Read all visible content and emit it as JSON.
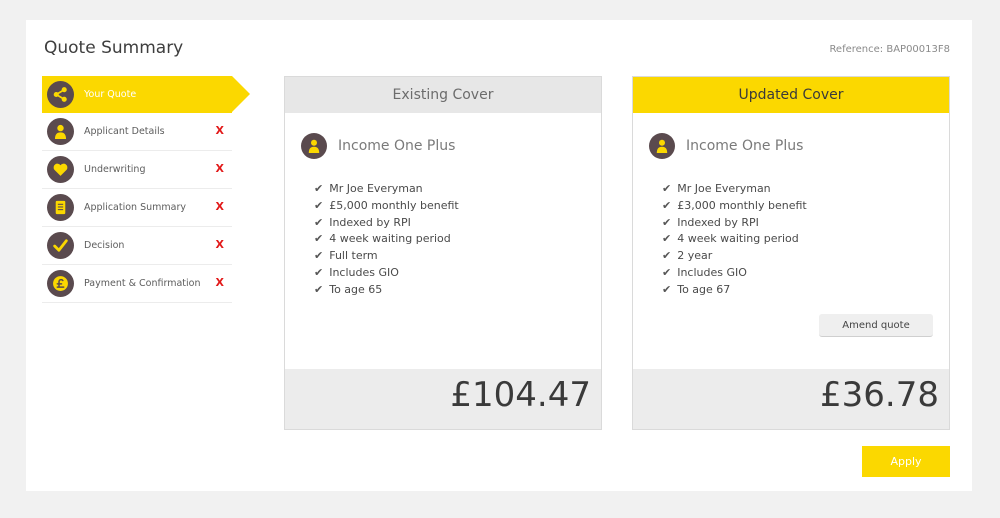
{
  "header": {
    "title": "Quote Summary",
    "reference": "Reference: BAP00013F8"
  },
  "steps": [
    {
      "label": "Your Quote",
      "icon": "share-icon",
      "status": ""
    },
    {
      "label": "Applicant Details",
      "icon": "person-icon",
      "status": "X"
    },
    {
      "label": "Underwriting",
      "icon": "heart-icon",
      "status": "X"
    },
    {
      "label": "Application Summary",
      "icon": "document-icon",
      "status": "X"
    },
    {
      "label": "Decision",
      "icon": "checkmark-icon",
      "status": "X"
    },
    {
      "label": "Payment & Confirmation",
      "icon": "pound-icon",
      "status": "X"
    }
  ],
  "existing": {
    "header": "Existing Cover",
    "product": "Income One Plus",
    "features": [
      "Mr Joe Everyman",
      "£5,000 monthly benefit",
      "Indexed by RPI",
      "4 week waiting period",
      "Full term",
      "Includes GIO",
      "To age 65"
    ],
    "price": "£104.47"
  },
  "updated": {
    "header": "Updated Cover",
    "product": "Income One Plus",
    "features": [
      "Mr Joe Everyman",
      "£3,000 monthly benefit",
      "Indexed by RPI",
      "4 week waiting period",
      "2 year",
      "Includes GIO",
      "To age 67"
    ],
    "amend_label": "Amend quote",
    "price": "£36.78"
  },
  "actions": {
    "apply_label": "Apply"
  },
  "colors": {
    "accent": "#fbd800",
    "icon_bg": "#5a4a4e",
    "error": "#e21a1a"
  }
}
